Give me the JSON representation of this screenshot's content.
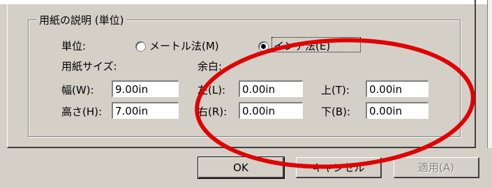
{
  "paper_description": {
    "group_title": "用紙の説明 (単位)",
    "unit_label": "単位:",
    "unit_options": [
      {
        "label": "メートル法(M)",
        "selected": false
      },
      {
        "label": "インチ法(E)",
        "selected": true
      }
    ],
    "paper_size_label": "用紙サイズ:",
    "width_label": "幅(W):",
    "width_value": "9.00in",
    "height_label": "高さ(H):",
    "height_value": "7.00in",
    "margins_label": "余白:",
    "left_label": "左(L):",
    "left_value": "0.00in",
    "right_label": "右(R):",
    "right_value": "0.00in",
    "top_label": "上(T):",
    "top_value": "0.00in",
    "bottom_label": "下(B):",
    "bottom_value": "0.00in"
  },
  "buttons": {
    "ok": "OK",
    "cancel": "キャンセル",
    "apply": "適用(A)"
  },
  "colors": {
    "dialog_bg": "#d4d0c8",
    "annotation": "#e00000"
  }
}
